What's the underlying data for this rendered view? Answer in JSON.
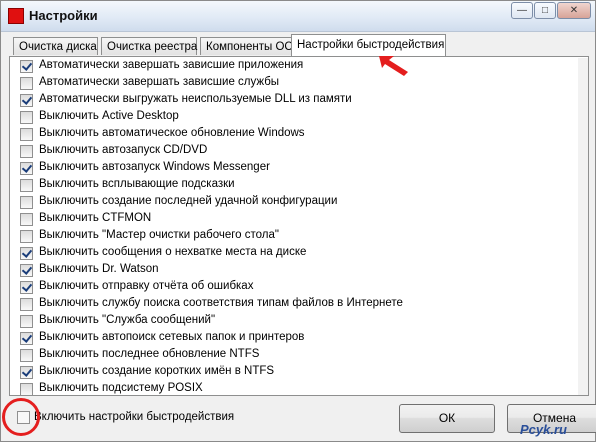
{
  "window": {
    "title": "Настройки"
  },
  "tabs": [
    {
      "label": "Очистка диска"
    },
    {
      "label": "Очистка реестра"
    },
    {
      "label": "Компоненты ОС"
    },
    {
      "label": "Настройки быстродействия"
    }
  ],
  "options": [
    {
      "label": "Автоматически завершать зависшие приложения",
      "checked": true
    },
    {
      "label": "Автоматически завершать зависшие службы",
      "checked": false
    },
    {
      "label": "Автоматически выгружать неиспользуемые DLL из памяти",
      "checked": true
    },
    {
      "label": "Выключить Active Desktop",
      "checked": false
    },
    {
      "label": "Выключить автоматическое обновление Windows",
      "checked": false
    },
    {
      "label": "Выключить автозапуск CD/DVD",
      "checked": false
    },
    {
      "label": "Выключить автозапуск Windows Messenger",
      "checked": true
    },
    {
      "label": "Выключить всплывающие подсказки",
      "checked": false
    },
    {
      "label": "Выключить создание последней удачной конфигурации",
      "checked": false
    },
    {
      "label": "Выключить CTFMON",
      "checked": false
    },
    {
      "label": "Выключить \"Мастер очистки рабочего стола\"",
      "checked": false
    },
    {
      "label": "Выключить сообщения о нехватке места на диске",
      "checked": true
    },
    {
      "label": "Выключить Dr. Watson",
      "checked": true
    },
    {
      "label": "Выключить отправку отчёта об ошибках",
      "checked": true
    },
    {
      "label": "Выключить службу поиска соответствия типам файлов в Интернете",
      "checked": false
    },
    {
      "label": "Выключить \"Служба сообщений\"",
      "checked": false
    },
    {
      "label": "Выключить автопоиск сетевых папок и принтеров",
      "checked": true
    },
    {
      "label": "Выключить последнее обновление NTFS",
      "checked": false
    },
    {
      "label": "Выключить создание коротких имён в NTFS",
      "checked": true
    },
    {
      "label": "Выключить подсистему POSIX",
      "checked": false
    }
  ],
  "footer": {
    "enable_label": "Включить настройки быстродействия",
    "enable_checked": false,
    "ok_label": "ОК",
    "cancel_label": "Отмена"
  },
  "watermark": "Pcyk.ru",
  "colors": {
    "accent_red": "#e41e1e",
    "check_mark": "#1a3d7a"
  }
}
